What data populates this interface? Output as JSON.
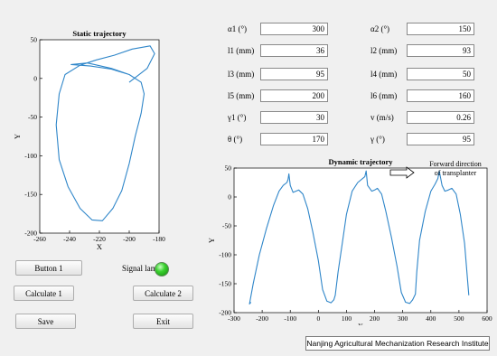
{
  "params": [
    {
      "label": "α1  (°)",
      "value": "300"
    },
    {
      "label": "α2  (°)",
      "value": "150"
    },
    {
      "label": "l1  (mm)",
      "value": "36"
    },
    {
      "label": "l2  (mm)",
      "value": "93"
    },
    {
      "label": "l3  (mm)",
      "value": "95"
    },
    {
      "label": "l4  (mm)",
      "value": "50"
    },
    {
      "label": "l5  (mm)",
      "value": "200"
    },
    {
      "label": "l6  (mm)",
      "value": "160"
    },
    {
      "label": "γ1  (°)",
      "value": "30"
    },
    {
      "label": "v  (m/s)",
      "value": "0.26"
    },
    {
      "label": "θ  (°)",
      "value": "170"
    },
    {
      "label": "γ  (°)",
      "value": "95"
    }
  ],
  "buttons": {
    "button1": "Button 1",
    "calculate1": "Calculate 1",
    "calculate2": "Calculate 2",
    "save": "Save",
    "exit": "Exit"
  },
  "signal_lamp_label": "Signal lamp",
  "signal_lamp_color": "#39d12e",
  "credit": "Nanjing Agricultural Mechanization Research Institute",
  "chart_data": [
    {
      "type": "line",
      "title": "Static trajectory",
      "xlabel": "X",
      "ylabel": "Y",
      "xlim": [
        -260,
        -180
      ],
      "ylim": [
        -200,
        50
      ],
      "xticks": [
        -260,
        -240,
        -220,
        -200,
        -180
      ],
      "yticks": [
        50,
        0,
        -50,
        -100,
        -150,
        -200
      ],
      "line_color": "#2f86c9",
      "series": [
        {
          "x": [
            -200,
            -188,
            -183,
            -186,
            -198,
            -210,
            -222,
            -233,
            -243,
            -247,
            -249,
            -247,
            -241,
            -233,
            -225,
            -218,
            -211,
            -205,
            -200,
            -196,
            -192,
            -190,
            -192,
            -200,
            -212,
            -226,
            -239,
            -228,
            -212,
            -200
          ],
          "y": [
            -5,
            13,
            32,
            42,
            38,
            30,
            24,
            17,
            5,
            -20,
            -60,
            -105,
            -140,
            -168,
            -183,
            -184,
            -168,
            -145,
            -110,
            -75,
            -45,
            -20,
            -5,
            5,
            12,
            16,
            18,
            20,
            13,
            5
          ]
        }
      ]
    },
    {
      "type": "line",
      "title": "Dynamic trajectory",
      "xlabel": "X",
      "ylabel": "Y",
      "xlim": [
        -300,
        600
      ],
      "ylim": [
        -200,
        50
      ],
      "xticks": [
        -300,
        -200,
        -100,
        0,
        100,
        200,
        300,
        400,
        500,
        600
      ],
      "yticks": [
        50,
        0,
        -50,
        -100,
        -150,
        -200
      ],
      "annotation": "Forward direction of transplanter",
      "line_color": "#2f86c9",
      "series": [
        {
          "x": [
            -240,
            -245,
            -232,
            -210,
            -185,
            -160,
            -140,
            -125,
            -112,
            -108,
            -105,
            -100,
            -90,
            -80,
            -70,
            -55,
            -38,
            -20,
            0,
            15,
            30,
            45,
            55,
            60,
            70,
            85,
            100,
            120,
            140,
            165,
            170,
            175,
            190,
            200,
            210,
            225,
            240,
            260,
            280,
            295,
            310,
            325,
            335,
            345,
            350,
            360,
            380,
            400,
            415,
            425,
            430,
            440,
            450,
            462,
            475,
            490,
            505,
            520,
            535
          ],
          "y": [
            -182,
            -185,
            -150,
            -100,
            -55,
            -15,
            10,
            20,
            25,
            30,
            40,
            20,
            8,
            10,
            12,
            5,
            -20,
            -60,
            -110,
            -160,
            -180,
            -183,
            -178,
            -170,
            -130,
            -80,
            -30,
            10,
            25,
            35,
            45,
            20,
            10,
            12,
            15,
            5,
            -25,
            -70,
            -120,
            -165,
            -182,
            -184,
            -178,
            -168,
            -130,
            -75,
            -25,
            10,
            22,
            32,
            45,
            20,
            10,
            12,
            15,
            5,
            -30,
            -80,
            -170
          ]
        }
      ]
    }
  ]
}
